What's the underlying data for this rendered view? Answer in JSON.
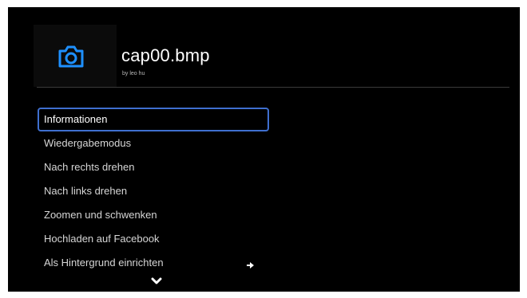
{
  "header": {
    "title": "cap00.bmp",
    "subtitle": "by leo hu",
    "icon": "camera-icon",
    "icon_color": "#1e90ff"
  },
  "menu": {
    "selected_index": 0,
    "items": [
      {
        "label": "Informationen"
      },
      {
        "label": "Wiedergabemodus"
      },
      {
        "label": "Nach rechts drehen"
      },
      {
        "label": "Nach links drehen"
      },
      {
        "label": "Zoomen und schwenken"
      },
      {
        "label": "Hochladen auf Facebook"
      },
      {
        "label": "Als Hintergrund einrichten"
      }
    ],
    "submenu_icon": "arrow-right-icon",
    "more_icon": "chevron-down-icon"
  },
  "colors": {
    "background": "#000000",
    "selection_border": "#3f6fcf",
    "text": "#d6d6d6"
  }
}
